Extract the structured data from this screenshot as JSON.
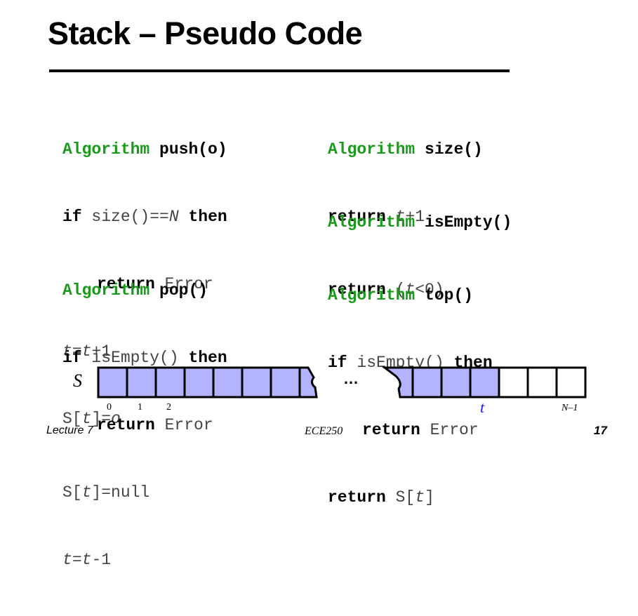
{
  "slide": {
    "title": "Stack – Pseudo Code",
    "footer_left": "Lecture 7",
    "footer_center": "ECE250",
    "footer_right": "17"
  },
  "colors": {
    "keyword_algorithm": "#1a9a1a",
    "keyword_bold": "#000000",
    "code_plain": "#444444",
    "cell_filled": "#b3b3ff",
    "cell_empty": "#ffffff",
    "index_t": "#1a1aff"
  },
  "algorithms": {
    "push": {
      "header_kw": "Algorithm",
      "header_name": "push(o)",
      "l1_if": "if",
      "l1_cond_a": " size()==",
      "l1_cond_b": "N",
      "l1_then": " then",
      "l2_return": "return",
      "l2_value": " Error",
      "l3_a": "t",
      "l3_b": "=",
      "l3_c": "t",
      "l3_d": "+1",
      "l4_a": "S[",
      "l4_b": "t",
      "l4_c": "]=",
      "l4_d": "o"
    },
    "pop": {
      "header_kw": "Algorithm",
      "header_name": "pop()",
      "l1_if": "if",
      "l1_cond": " isEmpty()",
      "l1_then": " then",
      "l2_return": "return",
      "l2_value": " Error",
      "l3_a": "S[",
      "l3_b": "t",
      "l3_c": "]=null",
      "l4_a": "t",
      "l4_b": "=",
      "l4_c": "t",
      "l4_d": "-1"
    },
    "size": {
      "header_kw": "Algorithm",
      "header_name": "size()",
      "l1_return": "return",
      "l1_a": " ",
      "l1_b": "t",
      "l1_c": "+1"
    },
    "isempty": {
      "header_kw": "Algorithm",
      "header_name": "isEmpty()",
      "l1_return": "return",
      "l1_a": " (",
      "l1_b": "t",
      "l1_c": "<0)"
    },
    "top": {
      "header_kw": "Algorithm",
      "header_name": "top()",
      "l1_if": "if",
      "l1_cond": " isEmpty()",
      "l1_then": " then",
      "l2_return": "return",
      "l2_value": " Error",
      "l3_return": "return",
      "l3_a": " S[",
      "l3_b": "t",
      "l3_c": "]"
    }
  },
  "array_diagram": {
    "label": "S",
    "ellipsis": "…",
    "index_0": "0",
    "index_1": "1",
    "index_2": "2",
    "index_t": "t",
    "index_last": "N–1",
    "left_filled_cells": 8,
    "right_filled_cells": 4,
    "right_empty_cells": 3
  }
}
